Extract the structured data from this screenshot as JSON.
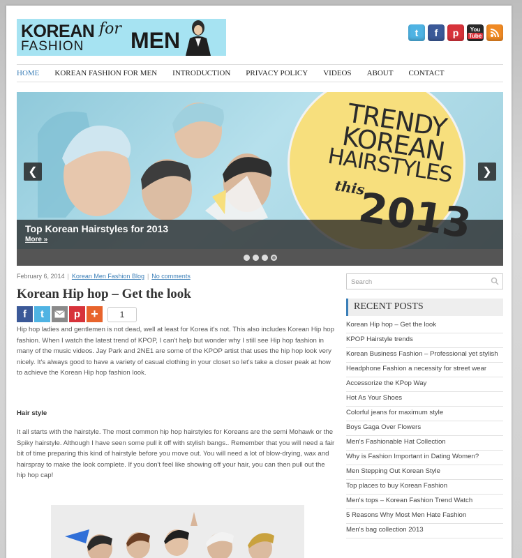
{
  "header": {
    "logo": {
      "line1": "KOREAN",
      "line2": "FASHION",
      "for": "for",
      "men": "MEN"
    },
    "social": [
      {
        "name": "twitter",
        "glyph": "t",
        "color": "#4fb3e3"
      },
      {
        "name": "facebook",
        "glyph": "f",
        "color": "#3b5998"
      },
      {
        "name": "pinterest",
        "glyph": "p",
        "color": "#d7333b"
      },
      {
        "name": "youtube",
        "glyph": "You Tube",
        "color": "#2a2a2a"
      },
      {
        "name": "rss",
        "glyph": "≋",
        "color": "#f08a24"
      }
    ]
  },
  "nav": {
    "items": [
      "HOME",
      "KOREAN FASHION FOR MEN",
      "INTRODUCTION",
      "PRIVACY POLICY",
      "VIDEOS",
      "ABOUT",
      "CONTACT"
    ]
  },
  "slider": {
    "headline": [
      "TRENDY",
      "KOREAN",
      "HAIRSTYLES"
    ],
    "this": "this",
    "year": "2013",
    "caption": "Top Korean Hairstyles for 2013",
    "more": "More »",
    "dot_count": 4,
    "active_dot": 4
  },
  "post": {
    "date": "February 6, 2014",
    "category": "Korean Men Fashion Blog",
    "comments": "No comments",
    "title": "Korean Hip hop – Get the look",
    "share_count": "1",
    "intro": "Hip hop ladies and gentlemen is not dead, well at least for Korea it's not. This also includes Korean Hip hop fashion. When I watch the latest trend of KPOP, I can't help but wonder why I still see Hip hop fashion in many of the music videos. Jay Park and 2NE1 are some of the KPOP artist that uses the hip hop look very nicely. It's always good to have a variety of casual clothing in your closet so let's take a closer peak at how to achieve the Korean Hip hop fashion look.",
    "subheading": "Hair style",
    "body": "It all starts with the hairstyle. The most common hip hop hairstyles for Koreans are the semi Mohawk or the Spiky hairstyle. Although I have seen some pull it off with stylish bangs.. Remember that you will need a fair bit of time preparing this kind of hairstyle before you move out. You will need a lot of blow-drying, wax and hairspray to make the look complete. If you don't feel like showing off your hair, you can then pull out the hip hop cap!"
  },
  "sidebar": {
    "search_placeholder": "Search",
    "recent_title": "RECENT POSTS",
    "recent_posts": [
      "Korean Hip hop – Get the look",
      "KPOP Hairstyle trends",
      "Korean Business Fashion – Professional yet stylish",
      "Headphone Fashion a necessity for street wear",
      "Accessorize the KPop Way",
      "Hot As Your Shoes",
      "Colorful jeans for maximum style",
      "Boys Gaga Over Flowers",
      "Men's Fashionable Hat Collection",
      "Why is Fashion Important in Dating Women?",
      "Men Stepping Out Korean Style",
      "Top places to buy Korean Fashion",
      "Men's tops – Korean Fashion Trend Watch",
      "5 Reasons Why Most Men Hate Fashion",
      "Men's bag collection 2013"
    ]
  },
  "colors": {
    "accent": "#3b7fb8",
    "slider_circle": "#f7df7d",
    "logo_bg": "#a6e3f2"
  }
}
